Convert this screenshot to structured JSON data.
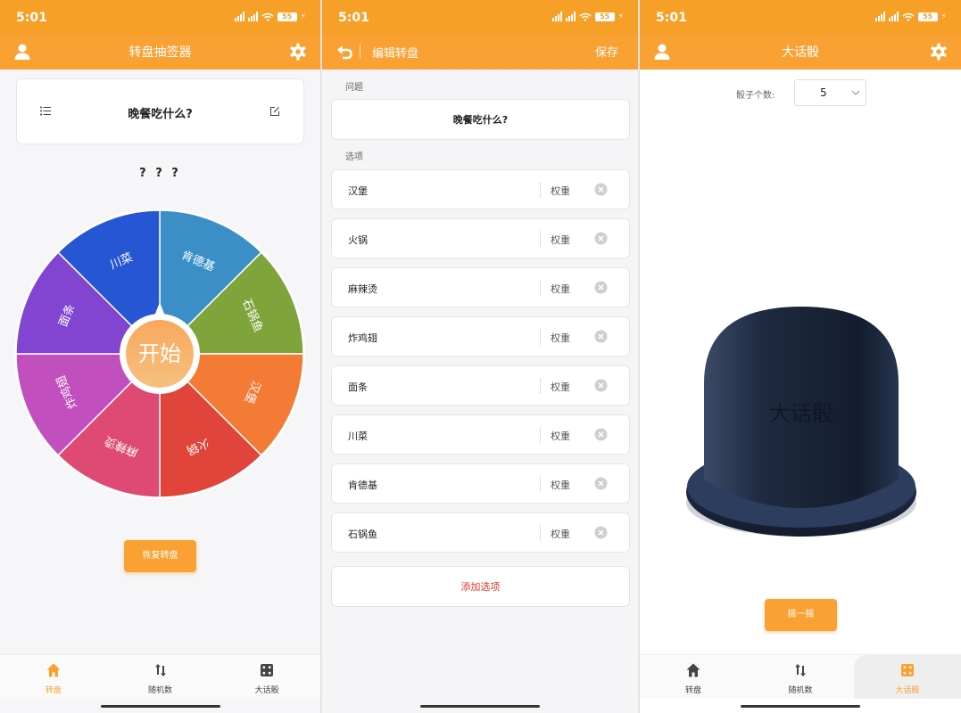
{
  "status": {
    "time": "5:01",
    "battery": "55"
  },
  "screen1": {
    "title": "转盘抽签器",
    "question": "晚餐吃什么?",
    "result": "? ? ?",
    "start_label": "开始",
    "reset_label": "恢复转盘",
    "wheel_segments": [
      {
        "label": "肯德基",
        "color": "#3b8fc6"
      },
      {
        "label": "石锅鱼",
        "color": "#7ea43b"
      },
      {
        "label": "汉堡",
        "color": "#f47b36"
      },
      {
        "label": "火锅",
        "color": "#e0443a"
      },
      {
        "label": "麻辣烫",
        "color": "#de4a73"
      },
      {
        "label": "炸鸡翅",
        "color": "#c14fbd"
      },
      {
        "label": "面条",
        "color": "#8145d2"
      },
      {
        "label": "川菜",
        "color": "#2756d4"
      }
    ]
  },
  "screen2": {
    "title": "编辑转盘",
    "save_label": "保存",
    "question_label": "问题",
    "question": "晚餐吃什么?",
    "options_label": "选项",
    "weight_label": "权重",
    "options": [
      "汉堡",
      "火锅",
      "麻辣烫",
      "炸鸡翅",
      "面条",
      "川菜",
      "肯德基",
      "石锅鱼"
    ],
    "add_label": "添加选项"
  },
  "screen3": {
    "title": "大话骰",
    "dice_count_label": "骰子个数:",
    "dice_count": "5",
    "cup_text": "大话骰",
    "shake_label": "摇一摇"
  },
  "tabs": [
    "转盘",
    "随机数",
    "大话骰"
  ],
  "colors": {
    "accent": "#f9a133",
    "danger": "#e0392b"
  }
}
